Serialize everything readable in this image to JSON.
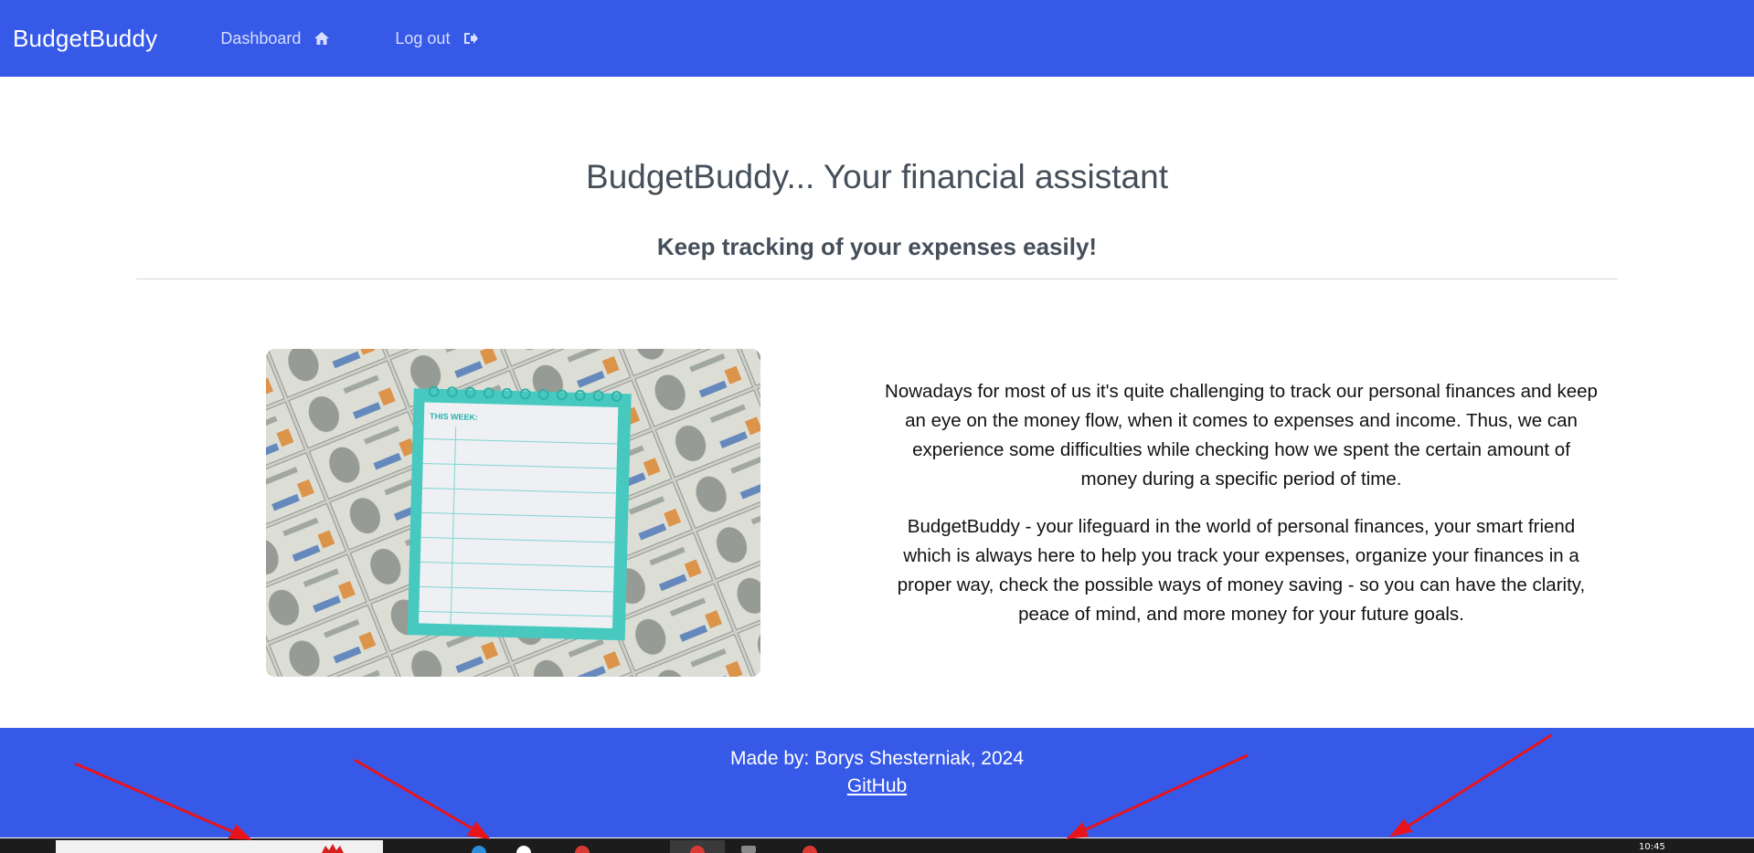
{
  "app": {
    "brand": "BudgetBuddy"
  },
  "nav": {
    "dashboard": {
      "label": "Dashboard",
      "icon": "home-icon"
    },
    "logout": {
      "label": "Log out",
      "icon": "sign-out-icon"
    }
  },
  "hero": {
    "title": "BudgetBuddy... Your financial assistant",
    "subtitle": "Keep tracking of your expenses easily!"
  },
  "about": {
    "paragraphs": [
      "Nowadays for most of us it's quite challenging to track our personal finances and keep an eye on the money flow, when it comes to expenses and income. Thus, we can experience some difficulties while checking how we spent the certain amount of money during a specific period of time.",
      "BudgetBuddy - your lifeguard in the world of personal finances, your smart friend which is always here to help you track your expenses, organize your finances in a proper way, check the possible ways of money saving - so you can have the clarity, peace of mind, and more money for your future goals."
    ]
  },
  "image": {
    "notepad_heading": "THIS WEEK:"
  },
  "footer": {
    "credit": "Made by: Borys Shesterniak, 2024",
    "link": "GitHub"
  },
  "taskbar": {
    "clock": "10:45"
  },
  "colors": {
    "primary": "#3659e8",
    "annotation_arrow": "#e8141c"
  }
}
